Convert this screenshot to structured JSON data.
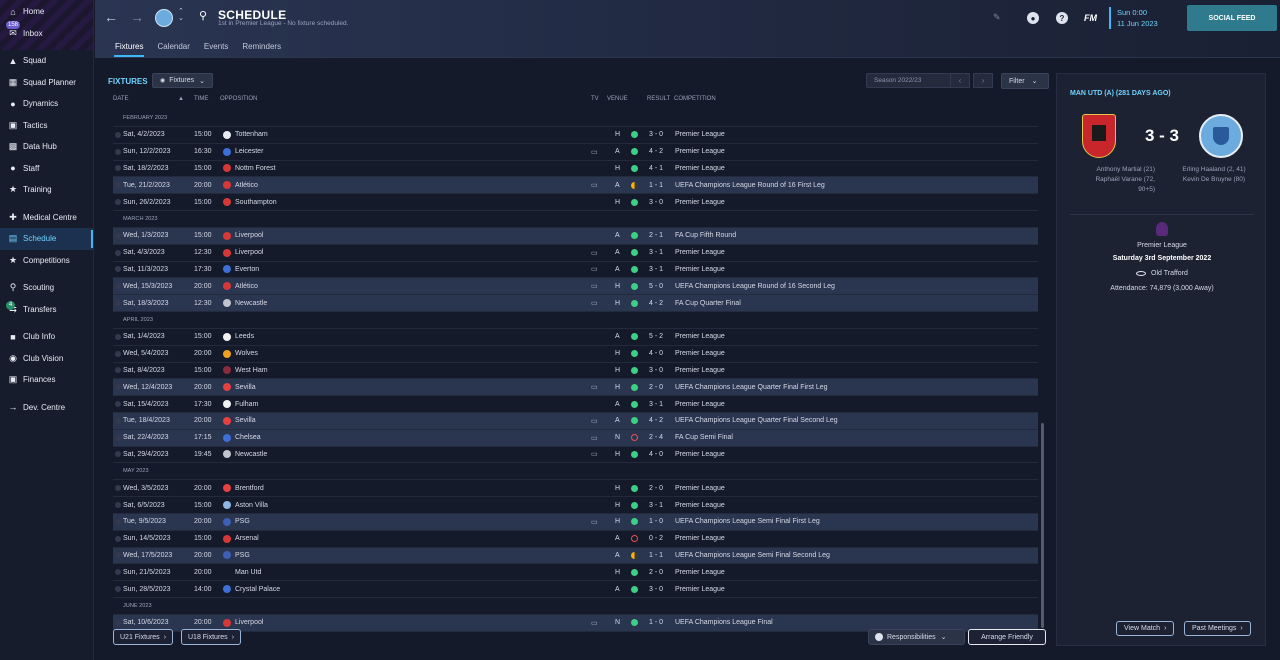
{
  "sidebar": {
    "items": [
      {
        "label": "Home",
        "icon": "home-icon"
      },
      {
        "label": "Inbox",
        "icon": "inbox-icon",
        "badge": "158"
      },
      {
        "label": "Squad",
        "icon": "shirt-icon"
      },
      {
        "label": "Squad Planner",
        "icon": "planner-icon"
      },
      {
        "label": "Dynamics",
        "icon": "dynamics-icon"
      },
      {
        "label": "Tactics",
        "icon": "tactics-icon"
      },
      {
        "label": "Data Hub",
        "icon": "data-hub-icon"
      },
      {
        "label": "Staff",
        "icon": "staff-icon"
      },
      {
        "label": "Training",
        "icon": "training-icon"
      },
      {
        "label": "Medical Centre",
        "icon": "medical-icon"
      },
      {
        "label": "Schedule",
        "icon": "calendar-icon",
        "active": true
      },
      {
        "label": "Competitions",
        "icon": "trophy-icon"
      },
      {
        "label": "Scouting",
        "icon": "scouting-icon"
      },
      {
        "label": "Transfers",
        "icon": "transfers-icon",
        "badge": "4"
      },
      {
        "label": "Club Info",
        "icon": "club-info-icon"
      },
      {
        "label": "Club Vision",
        "icon": "club-vision-icon"
      },
      {
        "label": "Finances",
        "icon": "finances-icon"
      },
      {
        "label": "Dev. Centre",
        "icon": "dev-centre-icon"
      }
    ]
  },
  "header": {
    "title": "SCHEDULE",
    "subtitle": "1st in Premier League - No fixture scheduled.",
    "tabs": [
      "Fixtures",
      "Calendar",
      "Events",
      "Reminders"
    ],
    "date_time": "Sun 0:00",
    "date": "11 Jun 2023",
    "fm_label": "FM",
    "help_label": "?",
    "social_feed": "SOCIAL FEED"
  },
  "fixtures": {
    "title": "FIXTURES",
    "view_dropdown": "Fixtures",
    "season": "Season 2022/23",
    "filter": "Filter",
    "columns": {
      "date": "DATE",
      "time": "TIME",
      "opposition": "OPPOSITION",
      "tv": "TV",
      "venue": "VENUE",
      "result": "RESULT",
      "competition": "COMPETITION"
    },
    "months": [
      {
        "name": "FEBRUARY 2023",
        "rows": [
          {
            "date": "Sat, 4/2/2023",
            "time": "15:00",
            "opp": "Tottenham",
            "tv": false,
            "venue": "H",
            "res": "W",
            "score": "3 - 0",
            "comp": "Premier League",
            "crest": "#e8ebf3",
            "hl": false
          },
          {
            "date": "Sun, 12/2/2023",
            "time": "16:30",
            "opp": "Leicester",
            "tv": true,
            "venue": "A",
            "res": "W",
            "score": "4 - 2",
            "comp": "Premier League",
            "crest": "#3d6fd6",
            "hl": false
          },
          {
            "date": "Sat, 18/2/2023",
            "time": "15:00",
            "opp": "Nottm Forest",
            "tv": false,
            "venue": "H",
            "res": "W",
            "score": "4 - 1",
            "comp": "Premier League",
            "crest": "#d63838",
            "hl": false
          },
          {
            "date": "Tue, 21/2/2023",
            "time": "20:00",
            "opp": "Atlético",
            "tv": true,
            "venue": "A",
            "res": "D",
            "score": "1 - 1",
            "comp": "UEFA Champions League Round of 16  First Leg",
            "crest": "#d63838",
            "hl": true
          },
          {
            "date": "Sun, 26/2/2023",
            "time": "15:00",
            "opp": "Southampton",
            "tv": false,
            "venue": "H",
            "res": "W",
            "score": "3 - 0",
            "comp": "Premier League",
            "crest": "#d63838",
            "hl": false
          }
        ]
      },
      {
        "name": "MARCH 2023",
        "rows": [
          {
            "date": "Wed, 1/3/2023",
            "time": "15:00",
            "opp": "Liverpool",
            "tv": false,
            "venue": "A",
            "res": "W",
            "score": "2 - 1",
            "comp": "FA Cup Fifth Round",
            "crest": "#d63838",
            "hl": true
          },
          {
            "date": "Sat, 4/3/2023",
            "time": "12:30",
            "opp": "Liverpool",
            "tv": true,
            "venue": "A",
            "res": "W",
            "score": "3 - 1",
            "comp": "Premier League",
            "crest": "#d63838",
            "hl": false
          },
          {
            "date": "Sat, 11/3/2023",
            "time": "17:30",
            "opp": "Everton",
            "tv": true,
            "venue": "A",
            "res": "W",
            "score": "3 - 1",
            "comp": "Premier League",
            "crest": "#3d6fd6",
            "hl": false
          },
          {
            "date": "Wed, 15/3/2023",
            "time": "20:00",
            "opp": "Atlético",
            "tv": true,
            "venue": "H",
            "res": "W",
            "score": "5 - 0",
            "comp": "UEFA Champions League Round of 16  Second Leg",
            "crest": "#d63838",
            "hl": true
          },
          {
            "date": "Sat, 18/3/2023",
            "time": "12:30",
            "opp": "Newcastle",
            "tv": true,
            "venue": "H",
            "res": "W",
            "score": "4 - 2",
            "comp": "FA Cup Quarter Final",
            "crest": "#bfc4cf",
            "hl": true
          }
        ]
      },
      {
        "name": "APRIL 2023",
        "rows": [
          {
            "date": "Sat, 1/4/2023",
            "time": "15:00",
            "opp": "Leeds",
            "tv": false,
            "venue": "A",
            "res": "W",
            "score": "5 - 2",
            "comp": "Premier League",
            "crest": "#f1f1f1",
            "hl": false
          },
          {
            "date": "Wed, 5/4/2023",
            "time": "20:00",
            "opp": "Wolves",
            "tv": false,
            "venue": "H",
            "res": "W",
            "score": "4 - 0",
            "comp": "Premier League",
            "crest": "#f0a020",
            "hl": false
          },
          {
            "date": "Sat, 8/4/2023",
            "time": "15:00",
            "opp": "West Ham",
            "tv": false,
            "venue": "H",
            "res": "W",
            "score": "3 - 0",
            "comp": "Premier League",
            "crest": "#8a2a3a",
            "hl": false
          },
          {
            "date": "Wed, 12/4/2023",
            "time": "20:00",
            "opp": "Sevilla",
            "tv": true,
            "venue": "H",
            "res": "W",
            "score": "2 - 0",
            "comp": "UEFA Champions League Quarter Final First Leg",
            "crest": "#e64040",
            "hl": true
          },
          {
            "date": "Sat, 15/4/2023",
            "time": "17:30",
            "opp": "Fulham",
            "tv": false,
            "venue": "A",
            "res": "W",
            "score": "3 - 1",
            "comp": "Premier League",
            "crest": "#f1f1f1",
            "hl": false
          },
          {
            "date": "Tue, 18/4/2023",
            "time": "20:00",
            "opp": "Sevilla",
            "tv": true,
            "venue": "A",
            "res": "W",
            "score": "4 - 2",
            "comp": "UEFA Champions League Quarter Final Second Leg",
            "crest": "#e64040",
            "hl": true
          },
          {
            "date": "Sat, 22/4/2023",
            "time": "17:15",
            "opp": "Chelsea",
            "tv": true,
            "venue": "N",
            "res": "L",
            "score": "2 - 4",
            "comp": "FA Cup Semi Final",
            "crest": "#3d6fd6",
            "hl": true
          },
          {
            "date": "Sat, 29/4/2023",
            "time": "19:45",
            "opp": "Newcastle",
            "tv": true,
            "venue": "H",
            "res": "W",
            "score": "4 - 0",
            "comp": "Premier League",
            "crest": "#bfc4cf",
            "hl": false
          }
        ]
      },
      {
        "name": "MAY 2023",
        "rows": [
          {
            "date": "Wed, 3/5/2023",
            "time": "20:00",
            "opp": "Brentford",
            "tv": false,
            "venue": "H",
            "res": "W",
            "score": "2 - 0",
            "comp": "Premier League",
            "crest": "#e64040",
            "hl": false
          },
          {
            "date": "Sat, 6/5/2023",
            "time": "15:00",
            "opp": "Aston Villa",
            "tv": false,
            "venue": "H",
            "res": "W",
            "score": "3 - 1",
            "comp": "Premier League",
            "crest": "#8fb8e6",
            "hl": false
          },
          {
            "date": "Tue, 9/5/2023",
            "time": "20:00",
            "opp": "PSG",
            "tv": true,
            "venue": "H",
            "res": "W",
            "score": "1 - 0",
            "comp": "UEFA Champions League Semi Final First Leg",
            "crest": "#3d5fb6",
            "hl": true
          },
          {
            "date": "Sun, 14/5/2023",
            "time": "15:00",
            "opp": "Arsenal",
            "tv": false,
            "venue": "A",
            "res": "L",
            "score": "0 - 2",
            "comp": "Premier League",
            "crest": "#d63838",
            "hl": false
          },
          {
            "date": "Wed, 17/5/2023",
            "time": "20:00",
            "opp": "PSG",
            "tv": false,
            "venue": "A",
            "res": "D",
            "score": "1 - 1",
            "comp": "UEFA Champions League Semi Final Second Leg",
            "crest": "#3d5fb6",
            "hl": true
          },
          {
            "date": "Sun, 21/5/2023",
            "time": "20:00",
            "opp": "Man Utd",
            "tv": false,
            "venue": "H",
            "res": "W",
            "score": "2 - 0",
            "comp": "Premier League",
            "crest": "",
            "hl": false
          },
          {
            "date": "Sun, 28/5/2023",
            "time": "14:00",
            "opp": "Crystal Palace",
            "tv": false,
            "venue": "A",
            "res": "W",
            "score": "3 - 0",
            "comp": "Premier League",
            "crest": "#3d6fd6",
            "hl": false
          }
        ]
      },
      {
        "name": "JUNE 2023",
        "rows": [
          {
            "date": "Sat, 10/6/2023",
            "time": "20:00",
            "opp": "Liverpool",
            "tv": true,
            "venue": "N",
            "res": "W",
            "score": "1 - 0",
            "comp": "UEFA Champions League Final",
            "crest": "#d63838",
            "hl": true
          }
        ]
      }
    ],
    "u21_btn": "U21 Fixtures",
    "u18_btn": "U18 Fixtures",
    "responsibilities": "Responsibilities",
    "arrange_friendly": "Arrange Friendly"
  },
  "match_panel": {
    "title": "MAN UTD (A) (281 DAYS AGO)",
    "score": "3 - 3",
    "home_scorers": [
      "Anthony Martial (21)",
      "Raphaël Varane (72,",
      "90+5)"
    ],
    "away_scorers": [
      "Erling Haaland (2, 41)",
      "Kevin De Bruyne (80)"
    ],
    "competition": "Premier League",
    "date": "Saturday 3rd September 2022",
    "stadium": "Old Trafford",
    "attendance": "Attendance: 74,879 (3,000 Away)",
    "view_match": "View Match",
    "past_meetings": "Past Meetings"
  }
}
